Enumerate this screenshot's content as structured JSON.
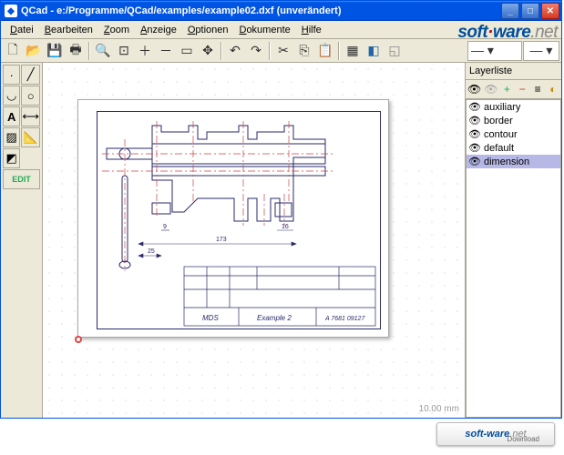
{
  "window": {
    "title": "QCad - e:/Programme/QCad/examples/example02.dxf (unverändert)"
  },
  "menu": {
    "items": [
      {
        "label": "Datei",
        "key": "D"
      },
      {
        "label": "Bearbeiten",
        "key": "B"
      },
      {
        "label": "Zoom",
        "key": "Z"
      },
      {
        "label": "Anzeige",
        "key": "A"
      },
      {
        "label": "Optionen",
        "key": "O"
      },
      {
        "label": "Dokumente",
        "key": "D"
      },
      {
        "label": "Hilfe",
        "key": "H"
      }
    ]
  },
  "watermark": {
    "part1": "soft",
    "dot": "·",
    "part2": "ware",
    "part3": ".net"
  },
  "layers": {
    "title": "Layerliste",
    "items": [
      {
        "name": "auxiliary",
        "visible": true,
        "selected": false
      },
      {
        "name": "border",
        "visible": true,
        "selected": false
      },
      {
        "name": "contour",
        "visible": true,
        "selected": false
      },
      {
        "name": "default",
        "visible": true,
        "selected": false
      },
      {
        "name": "dimension",
        "visible": true,
        "selected": true
      }
    ]
  },
  "canvas": {
    "scale": "10.00 mm",
    "dimensions": {
      "d1": "173",
      "d2": "25",
      "d3": "9",
      "d4": "16"
    },
    "titleblock": {
      "project": "MDS",
      "title": "Example 2",
      "number": "A 7681 09127"
    }
  },
  "left_tool_edit": "EDIT",
  "download_badge": {
    "part1": "soft-ware",
    "part2": ".net",
    "sub": "Download"
  }
}
